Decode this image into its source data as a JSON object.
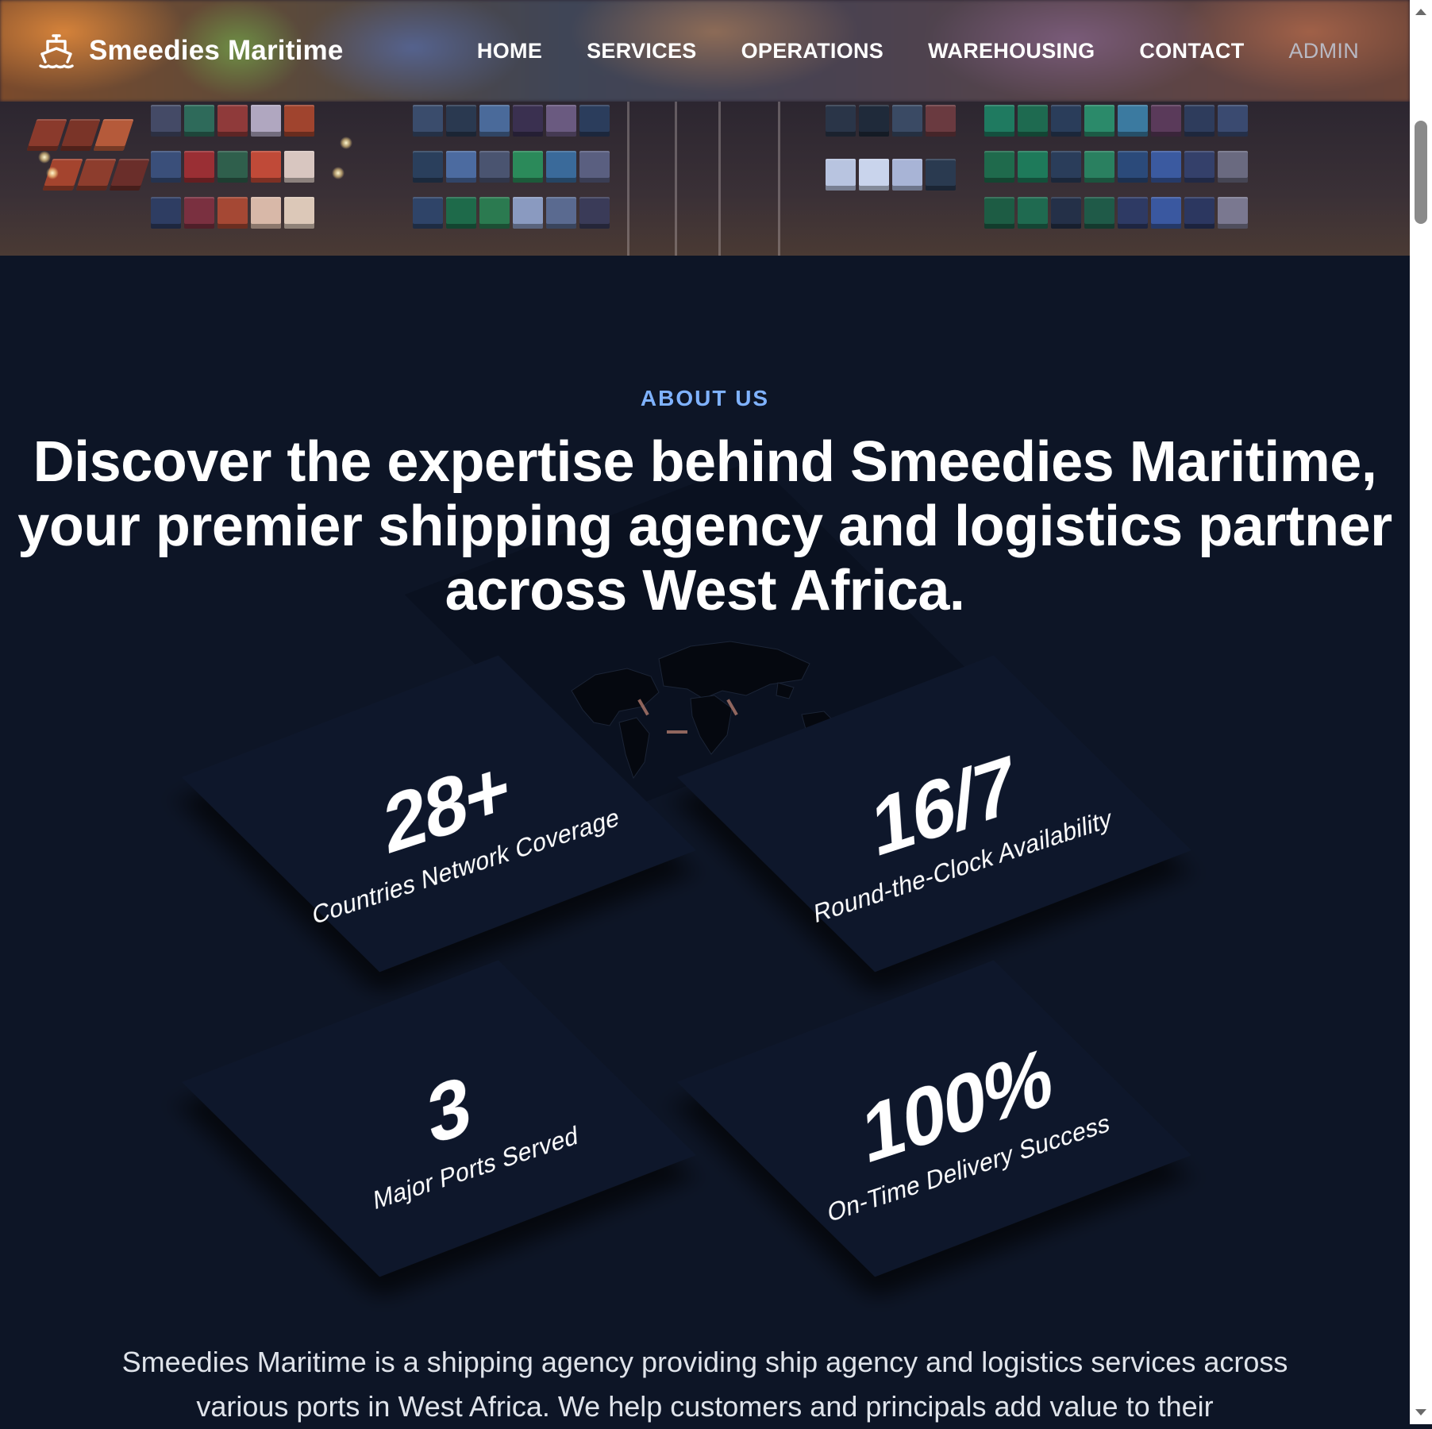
{
  "brand": {
    "name": "Smeedies Maritime",
    "logo_icon": "ship-icon"
  },
  "nav": {
    "items": [
      {
        "label": "HOME"
      },
      {
        "label": "SERVICES"
      },
      {
        "label": "OPERATIONS"
      },
      {
        "label": "WAREHOUSING"
      },
      {
        "label": "CONTACT"
      },
      {
        "label": "ADMIN"
      }
    ]
  },
  "about": {
    "label": "ABOUT US",
    "heading": "Discover the expertise behind Smeedies Maritime, your premier shipping agency and logistics partner across West Africa.",
    "stats": [
      {
        "value": "28+",
        "label": "Countries Network Coverage"
      },
      {
        "value": "16/7",
        "label": "Round-the-Clock Availability"
      },
      {
        "value": "3",
        "label": "Major Ports Served"
      },
      {
        "value": "100%",
        "label": "On-Time Delivery Success"
      }
    ],
    "body": "Smeedies Maritime is a shipping agency providing ship agency and logistics services across various ports in West Africa. We help customers and principals add value to their"
  },
  "colors": {
    "background": "#0d1526",
    "tile": "#0e172b",
    "accent_label": "#7fb2ff",
    "nav_admin": "#b9b9c3"
  }
}
